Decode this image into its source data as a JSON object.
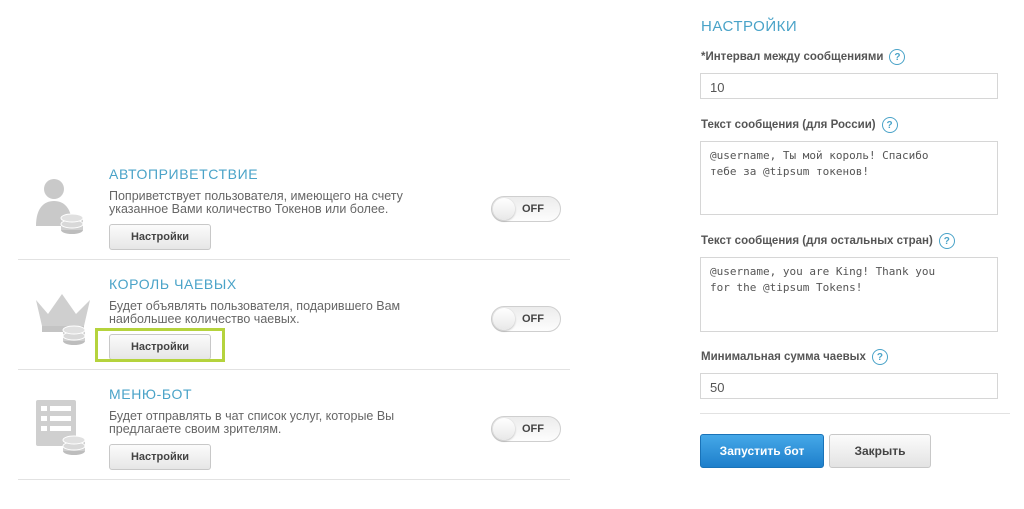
{
  "bots": [
    {
      "title": "АВТОПРИВЕТСТВИЕ",
      "description": "Поприветствует пользователя, имеющего на счету указанное Вами количество Токенов или более.",
      "settings_label": "Настройки",
      "toggle_label": "OFF",
      "icon": "user-coins-icon"
    },
    {
      "title": "КОРОЛЬ ЧАЕВЫХ",
      "description": "Будет объявлять пользователя, подарившего Вам наибольшее количество чаевых.",
      "settings_label": "Настройки",
      "toggle_label": "OFF",
      "icon": "crown-coins-icon"
    },
    {
      "title": "МЕНЮ-БОТ",
      "description": "Будет отправлять в чат список услуг, которые Вы предлагаете своим зрителям.",
      "settings_label": "Настройки",
      "toggle_label": "OFF",
      "icon": "menu-list-coins-icon"
    }
  ],
  "settings": {
    "heading": "НАСТРОЙКИ",
    "interval_label": "*Интервал между сообщениями",
    "interval_value": "10",
    "msg_russia_label": "Текст сообщения (для России)",
    "msg_russia_value": "@username, Ты мой король! Спасибо\nтебе за @tipsum токенов!",
    "msg_other_label": "Текст сообщения (для остальных стран)",
    "msg_other_value": "@username, you are King! Thank you\nfor the @tipsum Tokens!",
    "min_tip_label": "Минимальная сумма чаевых",
    "min_tip_value": "50",
    "start_label": "Запустить бот",
    "close_label": "Закрыть",
    "help_glyph": "?"
  },
  "colors": {
    "accent": "#4aa3c8",
    "highlight": "#b5d33d",
    "primary_button": "#2b8fd6"
  }
}
